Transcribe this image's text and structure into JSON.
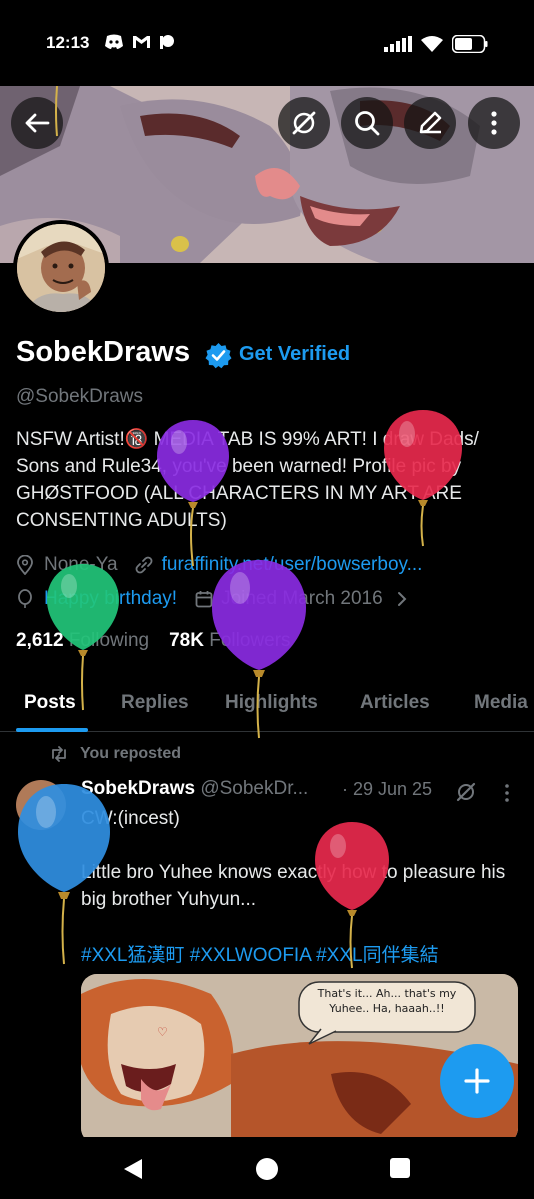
{
  "status_bar": {
    "time": "12:13",
    "left_icons": [
      "discord-icon",
      "gmail-icon",
      "patreon-icon"
    ],
    "right_icons": [
      "signal-icon",
      "wifi-icon",
      "battery-icon"
    ]
  },
  "header": {
    "buttons": [
      "back-arrow-icon",
      "grok-icon",
      "search-icon",
      "edit-icon",
      "more-vertical-icon"
    ]
  },
  "profile": {
    "display_name": "SobekDraws",
    "get_verified": "Get Verified",
    "handle": "@SobekDraws",
    "bio": "NSFW Artist!🔞 MEDIA TAB IS 99% ART! I draw Dads/ Sons and Rule34, you've been warned! Profile pic by GHØSTFOOD  (ALL CHARACTERS IN MY ART ARE CONSENTING ADULTS)",
    "location": "None-Ya",
    "website": "furaffinity.net/user/bowserboy...",
    "birthday": "Happy birthday!",
    "joined": "Joined March 2016",
    "following_count": "2,612",
    "following_label": "Following",
    "followers_count": "78K",
    "followers_label": "Followers"
  },
  "tabs": [
    {
      "label": "Posts",
      "active": true
    },
    {
      "label": "Replies"
    },
    {
      "label": "Highlights"
    },
    {
      "label": "Articles"
    },
    {
      "label": "Media"
    }
  ],
  "post": {
    "repost_label": "You reposted",
    "author_name": "SobekDraws",
    "author_handle": "@SobekDr...",
    "date": "· 29 Jun 25",
    "text_line1": "CW:(incest)",
    "text_body": "Little bro Yuhee knows exactly how to pleasure his big brother Yuhyun...",
    "hashtags": "#XXL猛漢町 #XXLWOOFIA #XXL同伴集結",
    "image_speech": "That's it... Ah... that's my Yuhee.. Ha, haaah..!!"
  },
  "colors": {
    "accent": "#1d9bf0",
    "background": "#000000",
    "muted_text": "#71767b"
  }
}
